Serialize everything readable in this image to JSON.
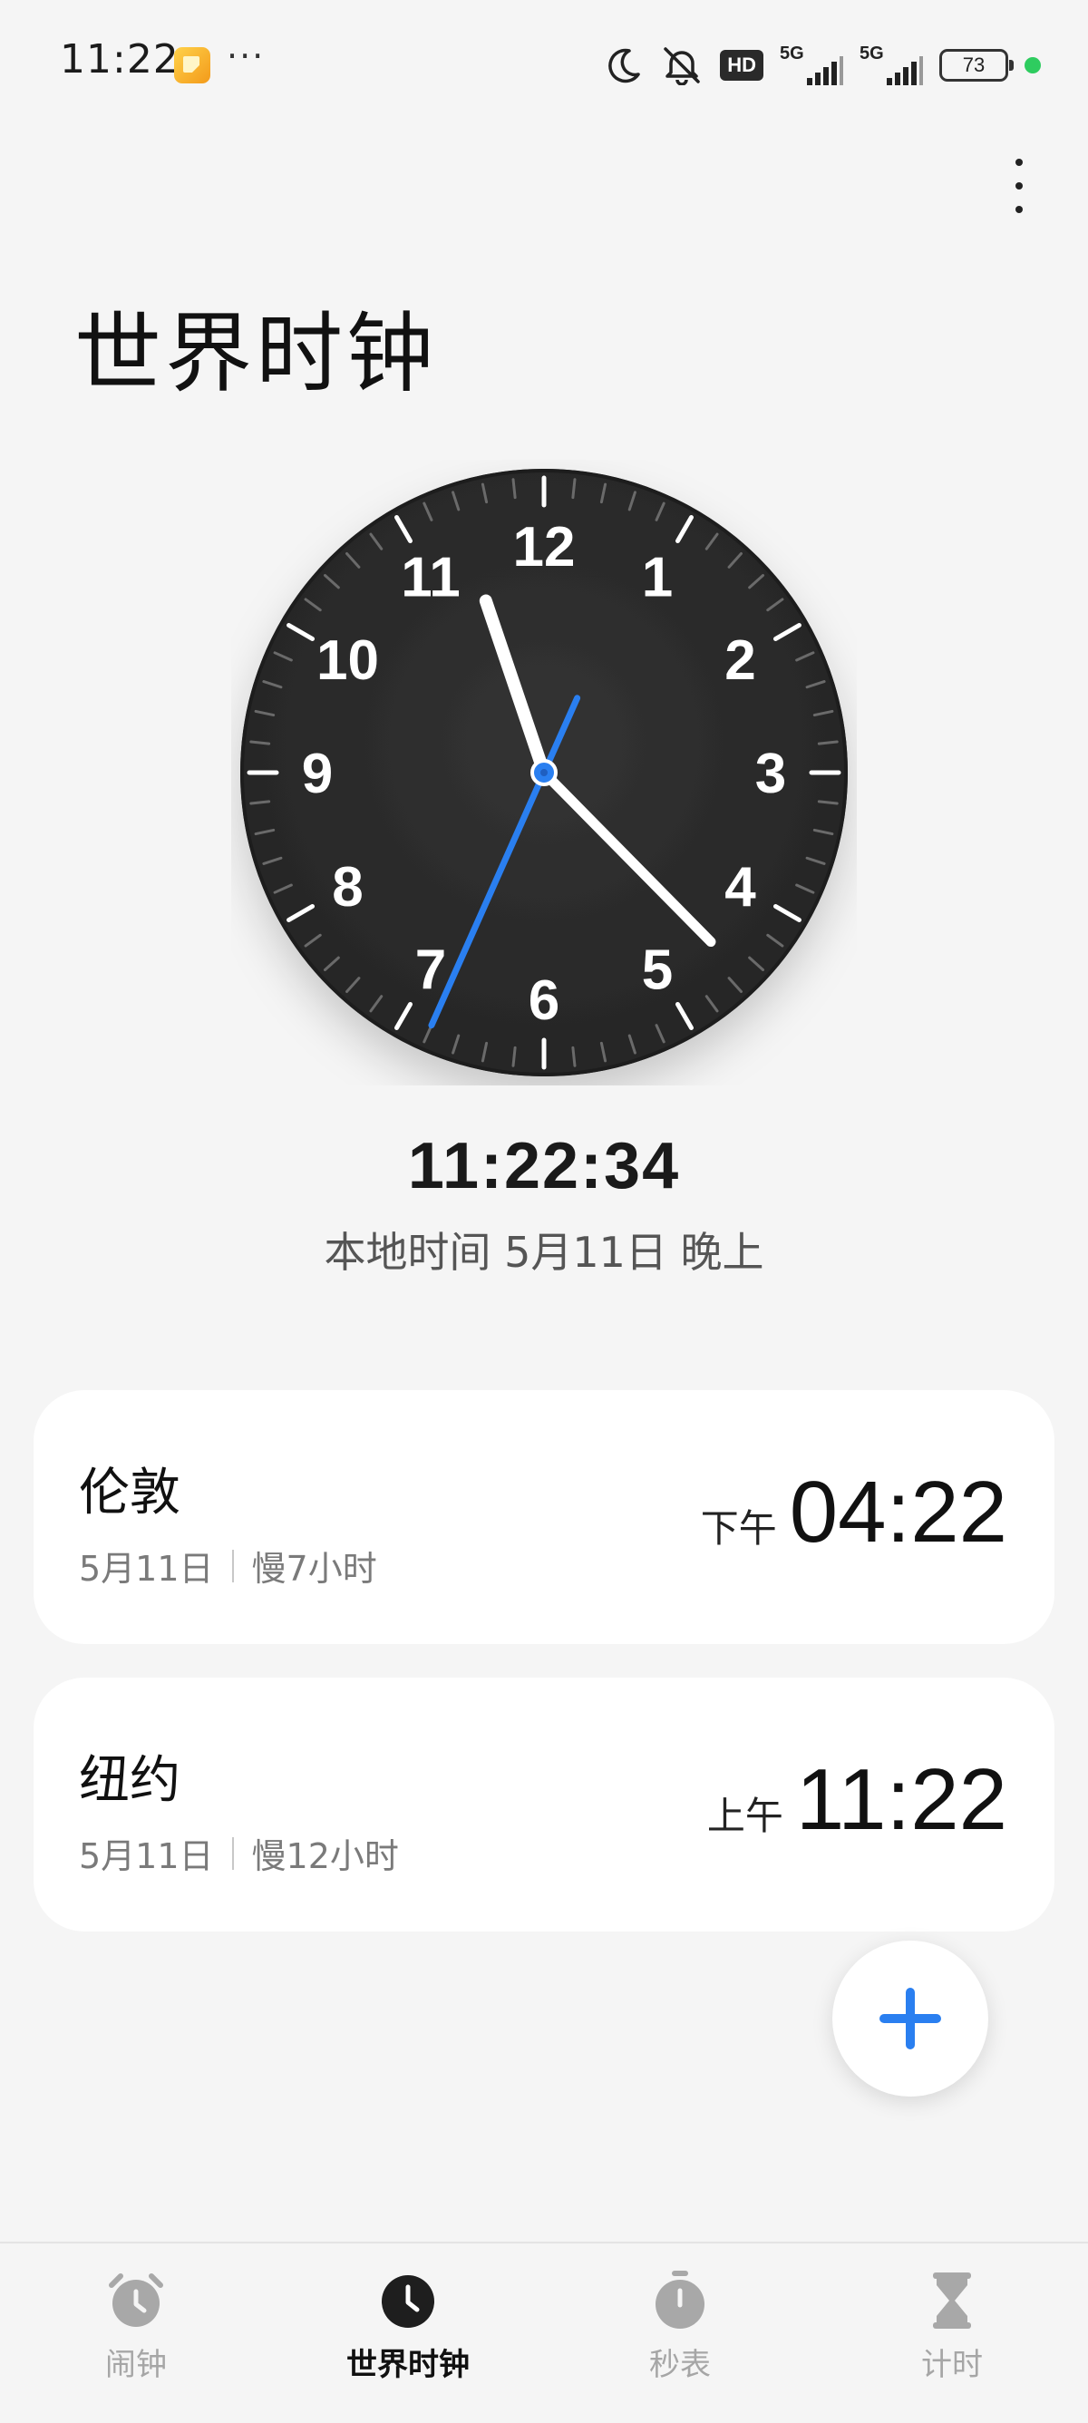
{
  "status_bar": {
    "time": "11:22",
    "more": "···",
    "hd_label": "HD",
    "network_1": "5G",
    "network_2": "5G",
    "battery": "73"
  },
  "page": {
    "title": "世界时钟"
  },
  "clock": {
    "hours": 11,
    "minutes": 22,
    "seconds": 34,
    "digital": "11:22:34",
    "local_date": "本地时间 5月11日 晚上",
    "dial_numbers": [
      "12",
      "1",
      "2",
      "3",
      "4",
      "5",
      "6",
      "7",
      "8",
      "9",
      "10",
      "11"
    ]
  },
  "cities": [
    {
      "name": "伦敦",
      "date": "5月11日",
      "offset": "慢7小时",
      "ampm": "下午",
      "time": "04:22"
    },
    {
      "name": "纽约",
      "date": "5月11日",
      "offset": "慢12小时",
      "ampm": "上午",
      "time": "11:22"
    }
  ],
  "bottom_nav": [
    {
      "label": "闹钟",
      "icon": "alarm-clock-icon",
      "active": false
    },
    {
      "label": "世界时钟",
      "icon": "clock-icon",
      "active": true
    },
    {
      "label": "秒表",
      "icon": "stopwatch-icon",
      "active": false
    },
    {
      "label": "计时",
      "icon": "hourglass-icon",
      "active": false
    }
  ],
  "colors": {
    "accent": "#2a7ff0",
    "background": "#f5f5f5",
    "dial": "#2c2c2c",
    "status_green": "#2ecc5f"
  }
}
